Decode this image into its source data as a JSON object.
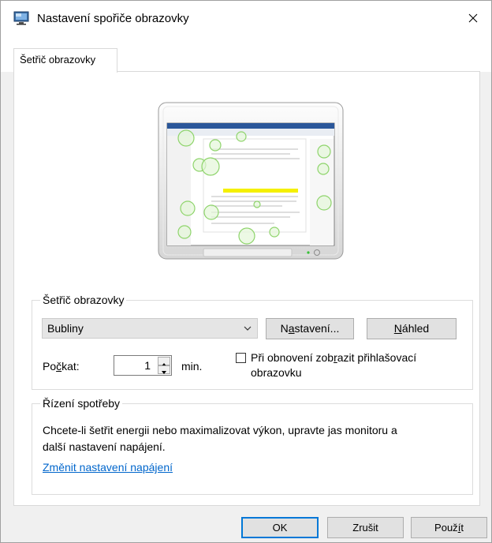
{
  "window": {
    "title": "Nastavení spořiče obrazovky",
    "tabs": [
      {
        "label": "Šetřič obrazovky",
        "active": true
      }
    ]
  },
  "screensaver": {
    "group_label": "Šetřič obrazovky",
    "selected": "Bubliny",
    "settings_button": {
      "pre": "N",
      "ul": "a",
      "post": "stavení..."
    },
    "preview_button": {
      "pre": "",
      "ul": "N",
      "post": "áhled"
    },
    "wait_label": {
      "pre": "Po",
      "ul": "č",
      "post": "kat:"
    },
    "wait_value": "1",
    "wait_unit": "min.",
    "resume_checkbox": {
      "checked": false,
      "pre": "Při obnovení zob",
      "ul": "r",
      "post": "azit přihlašovací obrazovku"
    }
  },
  "power": {
    "group_label": "Řízení spotřeby",
    "description": "Chcete-li šetřit energii nebo maximalizovat výkon, upravte jas monitoru a další nastavení napájení.",
    "link": "Změnit nastavení napájení"
  },
  "footer": {
    "ok": "OK",
    "cancel": "Zrušit",
    "apply": {
      "pre": "Použ",
      "ul": "í",
      "post": "t"
    }
  },
  "icons": {
    "app": "monitor-screensaver-icon",
    "close": "close-icon",
    "dropdown": "chevron-down-icon",
    "spin_up": "triangle-up-icon",
    "spin_down": "triangle-down-icon"
  },
  "colors": {
    "link": "#0066cc",
    "focus_border": "#0078d7",
    "button_face": "#e1e1e1",
    "dialog_bg": "#f0f0f0"
  }
}
